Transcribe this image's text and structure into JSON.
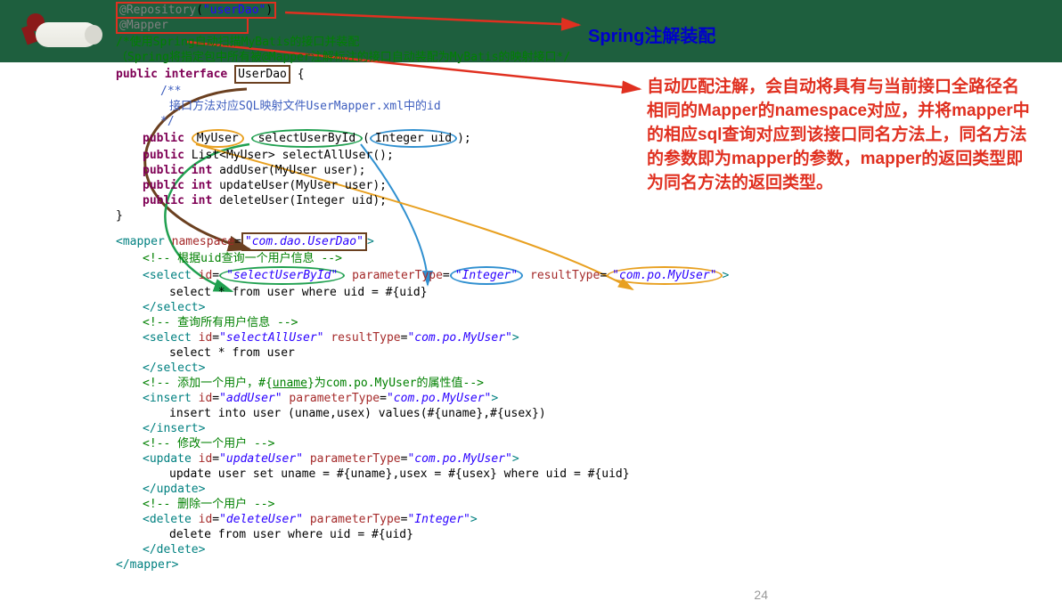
{
  "header": {
    "callout1": "Spring注解装配",
    "callout2": "自动匹配注解，会自动将具有与当前接口全路径名相同的Mapper的namespace对应，并将mapper中的相应sql查询对应到该接口同名方法上，同名方法的参数即为mapper的参数，mapper的返回类型即为同名方法的返回类型。"
  },
  "java": {
    "anno1": "@Repository",
    "anno1arg": "\"userDao\"",
    "anno2": "@Mapper",
    "c1": "/*使用Spring自动扫描MyBatis的接口并装配",
    "c2": "（Spring将指定包中所有被@Mapper注解标注的接口自动装配为MyBatis的映射接口*/",
    "pub": "public",
    "iface": "interface",
    "cls": "UserDao",
    "doc1": "/**",
    "doc2": "接口方法对应SQL映射文件UserMapper.xml中的id",
    "doc3": "*/",
    "ret1": "MyUser",
    "m1": "selectUserById",
    "p1t": "Integer",
    "p1n": "uid",
    "ret2a": "List",
    "ret2b": "MyUser",
    "m2": "selectAllUser",
    "ret3": "int",
    "m3": "addUser",
    "p3": "MyUser user",
    "m4": "updateUser",
    "p4": "MyUser user",
    "m5": "deleteUser",
    "p5": "Integer uid"
  },
  "xml": {
    "mapper": "mapper",
    "ns": "namespace",
    "nsv": "com.dao.UserDao",
    "c1": "<!-- 根据uid查询一个用户信息 -->",
    "sel": "select",
    "id": "id",
    "id1": "\"selectUserById\"",
    "pt": "parameterType",
    "ptv1": "\"Integer\"",
    "rt": "resultType",
    "rtv1": "\"com.po.MyUser\"",
    "q1": "select * from user where uid = #{uid}",
    "c2": "<!-- 查询所有用户信息 -->",
    "id2": "\"selectAllUser\"",
    "q2": "select * from user",
    "c3a": "<!-- 添加一个用户，#{",
    "c3u": "uname",
    "c3b": "}为com.po.MyUser的属性值-->",
    "ins": "insert",
    "id3": "\"addUser\"",
    "ptv2": "\"com.po.MyUser\"",
    "q3": "insert into user (uname,usex) values(#{uname},#{usex})",
    "c4": "<!-- 修改一个用户 -->",
    "upd": "update",
    "id4": "\"updateUser\"",
    "q4": "update user set uname = #{uname},usex = #{usex} where uid = #{uid}",
    "c5": "<!-- 删除一个用户 -->",
    "del": "delete",
    "id5": "\"deleteUser\"",
    "q5": "delete from user where uid = #{uid}"
  },
  "pagenum": "24"
}
